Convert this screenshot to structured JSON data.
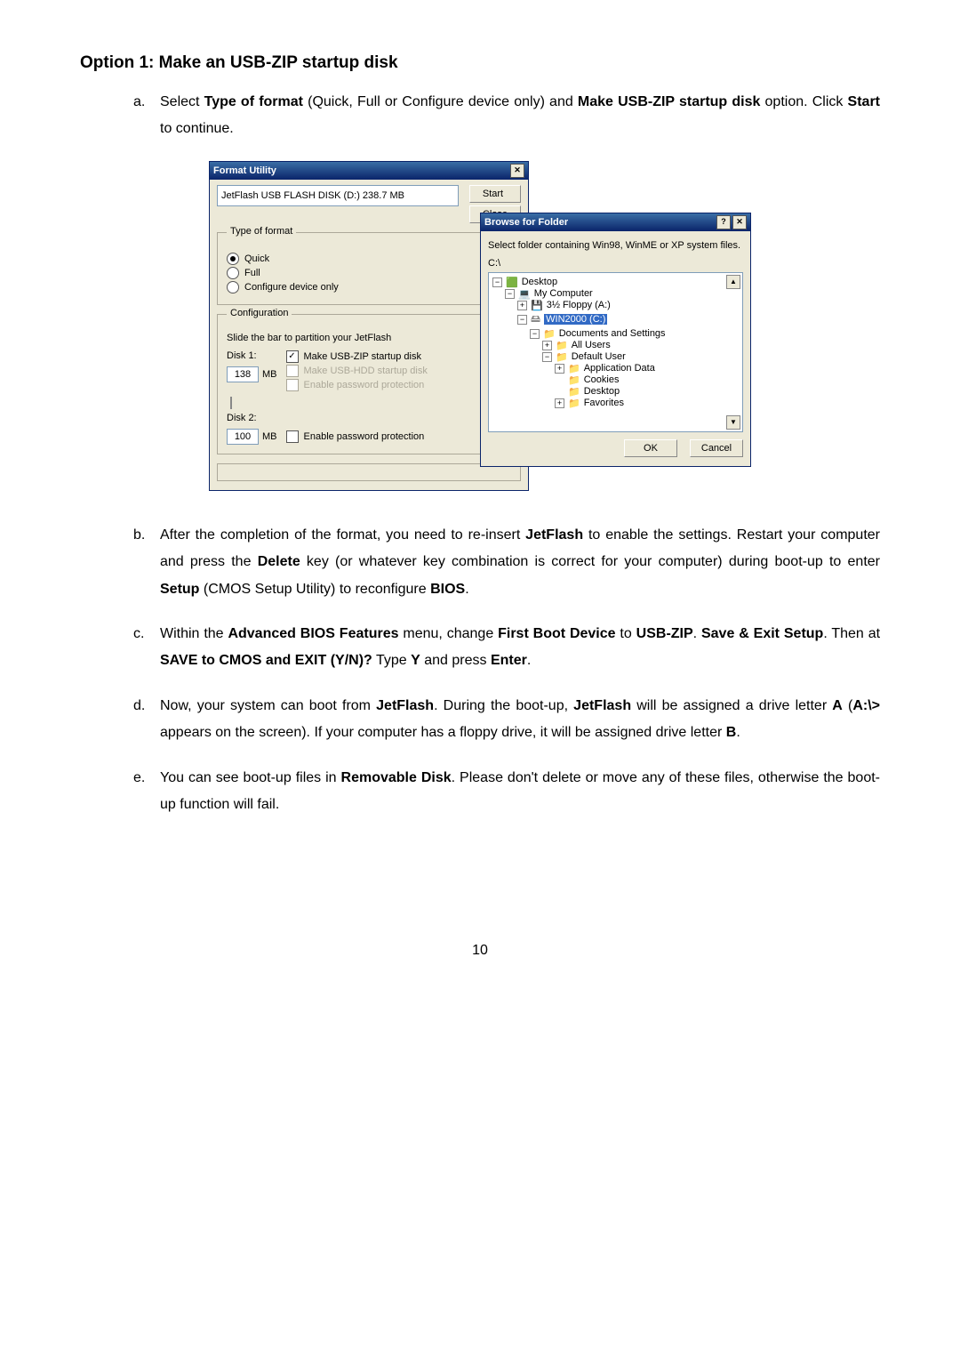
{
  "title": "Option 1: Make an USB-ZIP startup disk",
  "steps": {
    "a": {
      "letter": "a.",
      "p1a": "Select ",
      "p1b": "Type of format",
      "p1c": " (Quick, Full or Configure device only) and ",
      "p1d": "Make USB-ZIP startup disk",
      "p1e": " option. Click ",
      "p1f": "Start",
      "p1g": " to continue."
    },
    "b": {
      "letter": "b.",
      "t1": "After the completion of the format, you need to re-insert ",
      "t2": "JetFlash",
      "t3": " to enable the settings. Restart your computer and press the ",
      "t4": "Delete",
      "t5": " key (or whatever key combination is correct for your computer) during boot-up to enter ",
      "t6": "Setup",
      "t7": " (CMOS Setup Utility) to reconfigure ",
      "t8": "BIOS",
      "t9": "."
    },
    "c": {
      "letter": "c.",
      "t1": "Within the ",
      "t2": "Advanced BIOS Features",
      "t3": " menu, change ",
      "t4": "First Boot Device",
      "t5": " to ",
      "t6": "USB-ZIP",
      "t7": ". ",
      "t8": "Save & Exit Setup",
      "t9": ". Then at ",
      "t10": "SAVE to CMOS and EXIT (Y/N)?",
      "t11": " Type ",
      "t12": "Y",
      "t13": " and press ",
      "t14": "Enter",
      "t15": "."
    },
    "d": {
      "letter": "d.",
      "t1": "Now, your system can boot from ",
      "t2": "JetFlash",
      "t3": ". During the boot-up, ",
      "t4": "JetFlash",
      "t5": " will be assigned a drive letter ",
      "t6": "A",
      "t7": " (",
      "t8": "A:\\>",
      "t9": " appears on the screen). If your computer has a floppy drive, it will be assigned drive letter ",
      "t10": "B",
      "t11": "."
    },
    "e": {
      "letter": "e.",
      "t1": "You can see boot-up files in ",
      "t2": "Removable Disk",
      "t3": ". Please don't delete or move any of these files, otherwise the boot-up function will fail."
    }
  },
  "window1": {
    "title": "Format Utility",
    "device": "JetFlash USB FLASH DISK (D:)  238.7 MB",
    "start": "Start",
    "close": "Close",
    "grp_type": "Type of format",
    "r_quick": "Quick",
    "r_full": "Full",
    "r_cfg": "Configure device only",
    "grp_cfg": "Configuration",
    "slide": "Slide the bar to partition your JetFlash",
    "disk1": "Disk 1:",
    "chk_zip": "Make USB-ZIP startup disk",
    "chk_hdd": "Make USB-HDD startup disk",
    "chk_pw1": "Enable password protection",
    "disk1_val": "138",
    "mb": "MB",
    "disk2": "Disk 2:",
    "chk_pw2": "Enable password protection",
    "disk2_val": "100"
  },
  "window2": {
    "title": "Browse for Folder",
    "instr": "Select folder containing Win98, WinME or XP system files.",
    "path": "C:\\",
    "tree": {
      "desktop": "Desktop",
      "mycomp": "My Computer",
      "floppy": "3½ Floppy (A:)",
      "c": "WIN2000 (C:)",
      "docs": "Documents and Settings",
      "all": "All Users",
      "def": "Default User",
      "appd": "Application Data",
      "cook": "Cookies",
      "desk": "Desktop",
      "fav": "Favorites"
    },
    "ok": "OK",
    "cancel": "Cancel"
  },
  "pagenum": "10"
}
